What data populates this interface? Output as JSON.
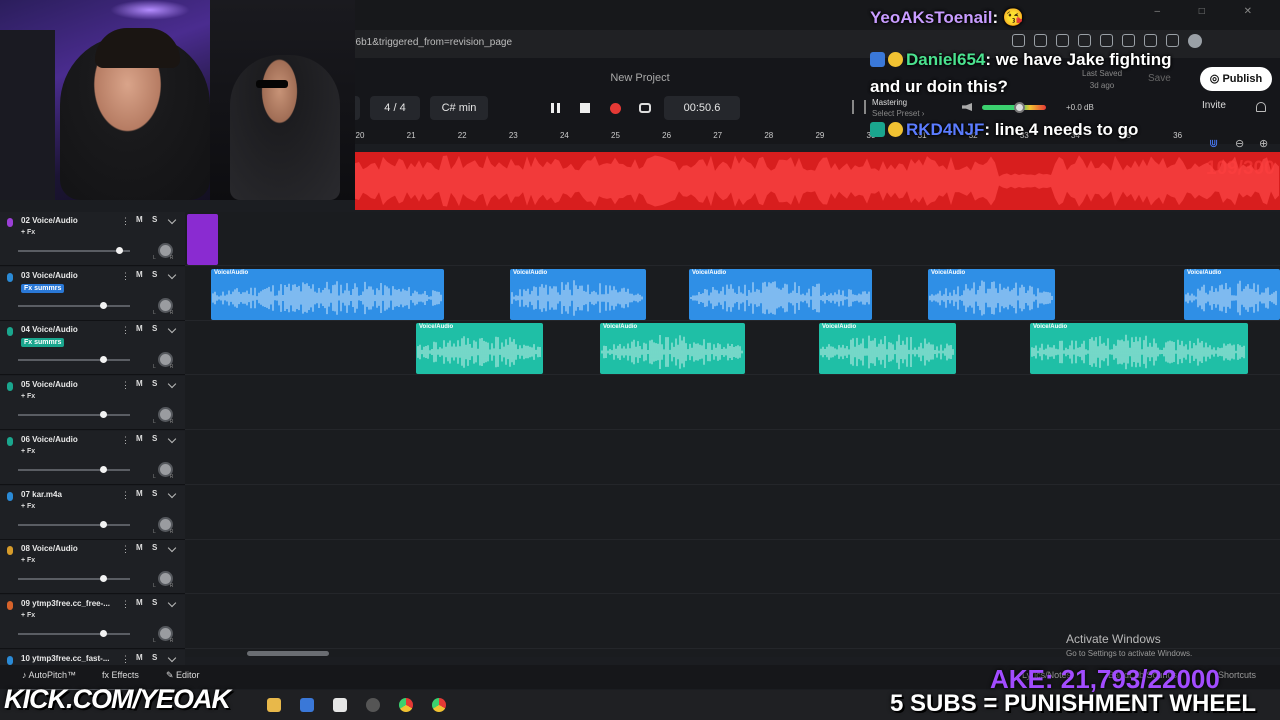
{
  "browser": {
    "url": "96b1&triggered_from=revision_page",
    "window_controls": "– □ ✕"
  },
  "header": {
    "project_title": "New Project",
    "time_signature": "4 / 4",
    "key": "C# min",
    "time": "00:50.6",
    "left_clip": "n",
    "last_saved_label": "Last Saved",
    "last_saved_value": "3d ago",
    "save_label": "Save",
    "publish_label": "Publish",
    "invite_label": "Invite",
    "mastering_label": "Mastering",
    "mastering_preset": "Select Preset ›",
    "db_readout": "+0.0 dB",
    "meter_level": 0.58
  },
  "ruler": {
    "bars": [
      "20",
      "21",
      "22",
      "23",
      "24",
      "25",
      "26",
      "27",
      "28",
      "29",
      "30",
      "31",
      "32",
      "33",
      "34",
      "35",
      "36"
    ]
  },
  "tracks": [
    {
      "name": "02 Voice/Audio",
      "fx": "+ Fx",
      "fx_active": false,
      "color": "#9b3fd6",
      "volume": 0.9
    },
    {
      "name": "03 Voice/Audio",
      "fx": "Fx summrs",
      "fx_active": true,
      "color": "#2a8ad6",
      "volume": 0.76
    },
    {
      "name": "04 Voice/Audio",
      "fx": "Fx summrs",
      "fx_active": true,
      "color": "#1aa68e",
      "volume": 0.76
    },
    {
      "name": "05 Voice/Audio",
      "fx": "+ Fx",
      "fx_active": false,
      "color": "#1aa68e",
      "volume": 0.76
    },
    {
      "name": "06 Voice/Audio",
      "fx": "+ Fx",
      "fx_active": false,
      "color": "#1aa68e",
      "volume": 0.76
    },
    {
      "name": "07 kar.m4a",
      "fx": "+ Fx",
      "fx_active": false,
      "color": "#2a8ad6",
      "volume": 0.76
    },
    {
      "name": "08 Voice/Audio",
      "fx": "+ Fx",
      "fx_active": false,
      "color": "#d69b2a",
      "volume": 0.76
    },
    {
      "name": "09 ytmp3free.cc_free-...",
      "fx": "+ Fx",
      "fx_active": false,
      "color": "#d6622a",
      "volume": 0.76
    },
    {
      "name": "10 ytmp3free.cc_fast-...",
      "fx": "+ Fx",
      "fx_active": false,
      "color": "#2a8ad6",
      "volume": 0.76
    }
  ],
  "mute_label": "M",
  "solo_label": "S",
  "clips": {
    "label": "Voice/Audio",
    "track03": [
      [
        211,
        233
      ],
      [
        510,
        136
      ],
      [
        689,
        183
      ],
      [
        928,
        127
      ],
      [
        1184,
        96
      ]
    ],
    "track04": [
      [
        416,
        127
      ],
      [
        600,
        145
      ],
      [
        819,
        137
      ],
      [
        1030,
        218
      ]
    ]
  },
  "bottom": {
    "autopitch": "AutoPitch™",
    "effects": "Effects",
    "editor": "Editor",
    "lyrics": "Lyrics/Notes",
    "sounds": "BandLab Sounds",
    "shortcuts": "Shortcuts"
  },
  "windows": {
    "activate_title": "Activate Windows",
    "activate_sub": "Go to Settings to activate Windows."
  },
  "chat": [
    {
      "user": "YeoAKsToenail",
      "sep": ":",
      "message": " 😘",
      "user_color": "#c89cff"
    },
    {
      "user": "Daniel654",
      "sep": ":",
      "message": " we have Jake fighting",
      "user_color": "#4be28f"
    },
    {
      "user": "",
      "sep": "",
      "message": "and ur doin this?",
      "user_color": "#4be28f"
    },
    {
      "user": "RKD4NJF",
      "sep": ":",
      "message": " line 4 needs to go",
      "user_color": "#5b7cff"
    }
  ],
  "stream": {
    "kick_url": "KICK.COM/YEOAK",
    "subs_text": "5 SUBS = PUNISHMENT WHEEL",
    "goal_text": "AKE: 21,793/22000",
    "counter_text": "109/300"
  },
  "colors": {
    "master": "#d81e1e",
    "clip_blue": "#2f8fe6",
    "clip_teal": "#1fbfa6",
    "accent_red": "#e53935"
  }
}
